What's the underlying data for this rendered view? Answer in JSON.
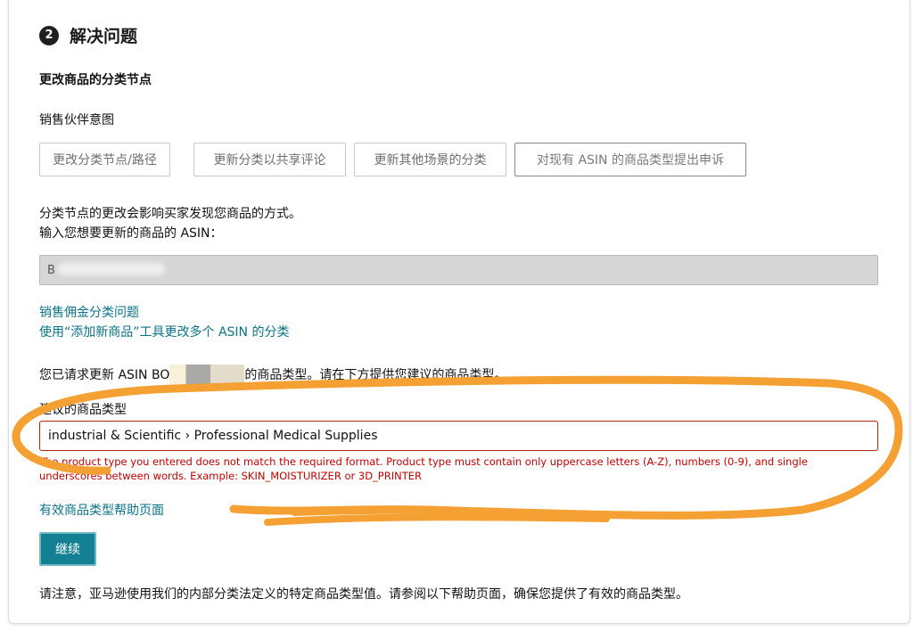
{
  "step": {
    "number": "2",
    "title": "解决问题"
  },
  "section": {
    "title": "更改商品的分类节点",
    "intent_label": "销售伙伴意图",
    "intents": [
      {
        "label": "更改分类节点/路径"
      },
      {
        "label": "更新分类以共享评论"
      },
      {
        "label": "更新其他场景的分类"
      },
      {
        "label": "对现有 ASIN 的商品类型提出申诉"
      }
    ]
  },
  "description": {
    "line1": "分类节点的更改会影响买家发现您商品的方式。",
    "line2": "输入您想要更新的商品的 ASIN："
  },
  "asin_input": {
    "value": "B"
  },
  "links": {
    "commission_issue": "销售佣金分类问题",
    "bulk_tool": "使用“添加新商品”工具更改多个 ASIN 的分类",
    "valid_types_help": "有效商品类型帮助页面"
  },
  "request": {
    "prefix": "您已请求更新 ASIN BO",
    "suffix": "的商品类型。请在下方提供您建议的商品类型。"
  },
  "suggested_type": {
    "label": "建议的商品类型",
    "value": "industrial & Scientific › Professional Medical Supplies",
    "error": "The product type you entered does not match the required format. Product type must contain only uppercase letters (A-Z), numbers (0-9), and single underscores between words. Example: SKIN_MOISTURIZER or 3D_PRINTER"
  },
  "actions": {
    "continue_label": "继续"
  },
  "note": "请注意，亚马逊使用我们的内部分类法定义的特定商品类型值。请参阅以下帮助页面，确保您提供了有效的商品类型。",
  "colors": {
    "link": "#0a7387",
    "error": "#c40000",
    "primary_button": "#138193",
    "annotation": "#f5a033"
  },
  "icons": {
    "step_badge": "numbered-circle-icon"
  }
}
